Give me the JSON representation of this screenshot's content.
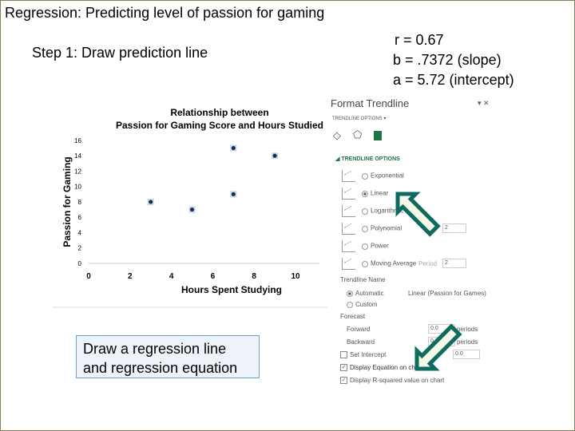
{
  "slide": {
    "title": "Regression: Predicting level of passion for gaming",
    "step": "Step 1: Draw prediction line",
    "stats": {
      "r": "r =  0.67",
      "b": "b = .7372 (slope)",
      "a": "a = 5.72 (intercept)"
    },
    "note": "Draw a regression line and regression equation"
  },
  "chart_data": {
    "type": "scatter",
    "title": "Relationship between Passion for Gaming Score and Hours Studied",
    "title_line1": "Relationship between",
    "title_line2": "Passion for Gaming Score and Hours Studied",
    "xlabel": "Hours Spent Studying",
    "ylabel": "Passion for Gaming",
    "xlim": [
      0,
      11
    ],
    "ylim": [
      0,
      16
    ],
    "xticks": [
      0,
      2,
      4,
      6,
      8,
      10
    ],
    "yticks": [
      0,
      2,
      4,
      6,
      8,
      10,
      12,
      14,
      16
    ],
    "points": [
      {
        "x": 3,
        "y": 8
      },
      {
        "x": 5,
        "y": 7
      },
      {
        "x": 7,
        "y": 15
      },
      {
        "x": 7,
        "y": 9
      },
      {
        "x": 9,
        "y": 14
      }
    ],
    "marker_color": "#1a2a4a",
    "grid": false
  },
  "pane": {
    "title": "Format Trendline",
    "section_tab": "TRENDLINE OPTIONS",
    "section": "TRENDLINE OPTIONS",
    "types": [
      {
        "label": "Exponential",
        "selected": false
      },
      {
        "label": "Linear",
        "selected": true
      },
      {
        "label": "Logarithmic",
        "selected": false
      },
      {
        "label": "Polynomial",
        "selected": false,
        "extra": "2"
      },
      {
        "label": "Power",
        "selected": false
      },
      {
        "label": "Moving Average",
        "selected": false,
        "extra_label": "Period",
        "extra": "2"
      }
    ],
    "name_label": "Trendline Name",
    "automatic": "Automatic",
    "automatic_value": "Linear (Passion for Games)",
    "custom": "Custom",
    "forecast": "Forecast",
    "forward": "Forward",
    "forward_value": "0.0",
    "backward": "Backward",
    "backward_value": "0.0",
    "periods": "periods",
    "set_intercept": "Set Intercept",
    "intercept_value": "0.0",
    "display_equation": "Display Equation on chart",
    "display_r2": "Display R-squared value on chart"
  },
  "colors": {
    "accent": "#217346",
    "arrow": "#0e6b5e"
  }
}
